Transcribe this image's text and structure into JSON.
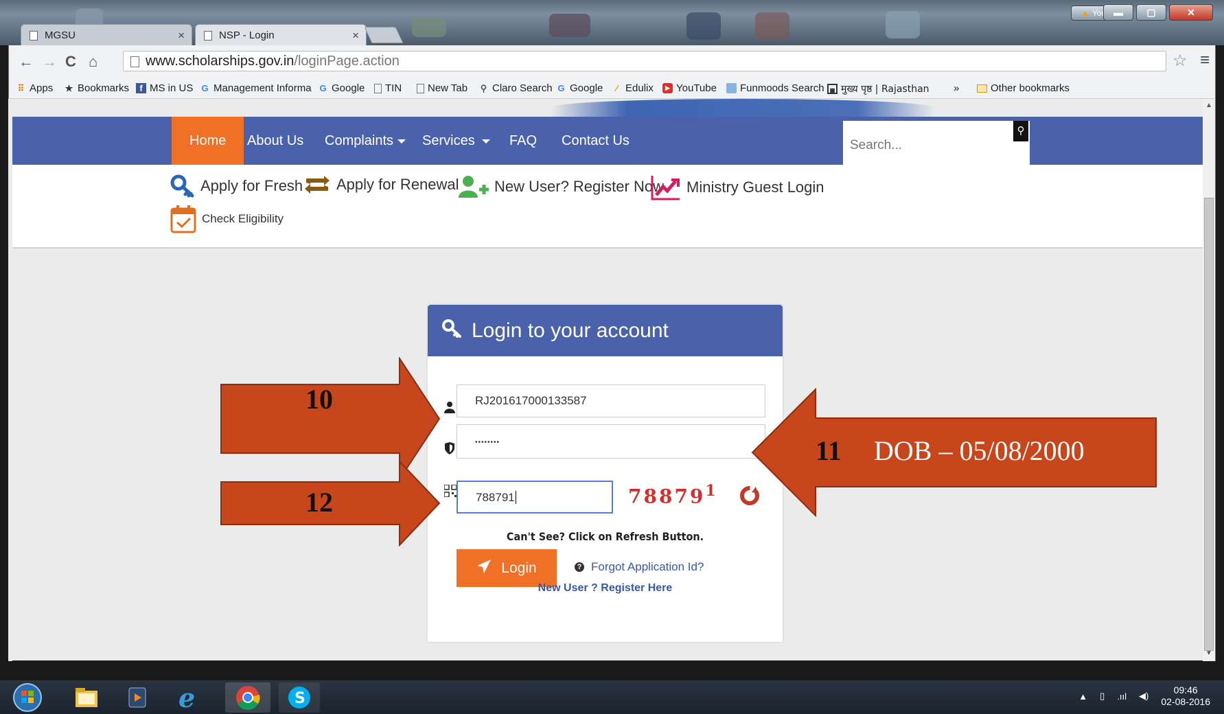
{
  "browser": {
    "tabs": [
      {
        "label": "MGSU",
        "active": false
      },
      {
        "label": "NSP - Login",
        "active": true
      }
    ],
    "tab_close": "×",
    "profile_badge": "You",
    "url_host": "www.scholarships.gov.in",
    "url_path": "/loginPage.action",
    "bookmarks": [
      {
        "label": "Apps",
        "icon": "apps-grid-icon"
      },
      {
        "label": "Bookmarks",
        "icon": "star-icon"
      },
      {
        "label": "MS in US",
        "icon": "facebook-icon"
      },
      {
        "label": "Management Informa",
        "icon": "google-icon"
      },
      {
        "label": "Google",
        "icon": "google-icon"
      },
      {
        "label": "TIN",
        "icon": "page-icon"
      },
      {
        "label": "New Tab",
        "icon": "page-icon"
      },
      {
        "label": "Claro Search",
        "icon": "search-icon"
      },
      {
        "label": "Google",
        "icon": "google-icon"
      },
      {
        "label": "Edulix",
        "icon": "pen-icon"
      },
      {
        "label": "YouTube",
        "icon": "youtube-icon"
      },
      {
        "label": "Funmoods Search",
        "icon": "funmoods-icon"
      },
      {
        "label": "मुख्य पृष्ठ | Rajasthan",
        "icon": "grid-icon"
      },
      {
        "label": "»",
        "icon": ""
      },
      {
        "label": "Other bookmarks",
        "icon": "folder-icon"
      }
    ]
  },
  "site": {
    "nav": [
      {
        "label": "Home",
        "active": true
      },
      {
        "label": "About Us"
      },
      {
        "label": "Complaints",
        "dropdown": true
      },
      {
        "label": "Services",
        "dropdown": true
      },
      {
        "label": "FAQ"
      },
      {
        "label": "Contact Us"
      }
    ],
    "search_placeholder": "Search...",
    "quick_links": [
      {
        "label": "Apply for Fresh",
        "icon": "key-icon"
      },
      {
        "label": "Apply for Renewal",
        "icon": "renew-icon"
      },
      {
        "label": "New User? Register Now",
        "icon": "add-user-icon"
      },
      {
        "label": "Ministry Guest Login",
        "icon": "trend-chart-icon"
      },
      {
        "label": "Check Eligibility",
        "icon": "calendar-check-icon"
      }
    ],
    "login": {
      "title": "Login to your account",
      "application_id": "RJ201617000133587",
      "password_mask": "••••••••",
      "captcha_input": "788791",
      "captcha_text_main": "78879",
      "captcha_text_sup": "1",
      "hint": "Can't See? Click on Refresh Button.",
      "login_button": "Login",
      "forgot_link": "Forgot Application Id?",
      "register_link": "New User ? Register Here"
    },
    "footer_text": ""
  },
  "annotations": {
    "arrow_10": "10",
    "arrow_11": "11",
    "arrow_11_note": "DOB – 05/08/2000",
    "arrow_12": "12",
    "color": "#c8461b"
  },
  "taskbar": {
    "time": "09:46",
    "date": "02-08-2016"
  }
}
